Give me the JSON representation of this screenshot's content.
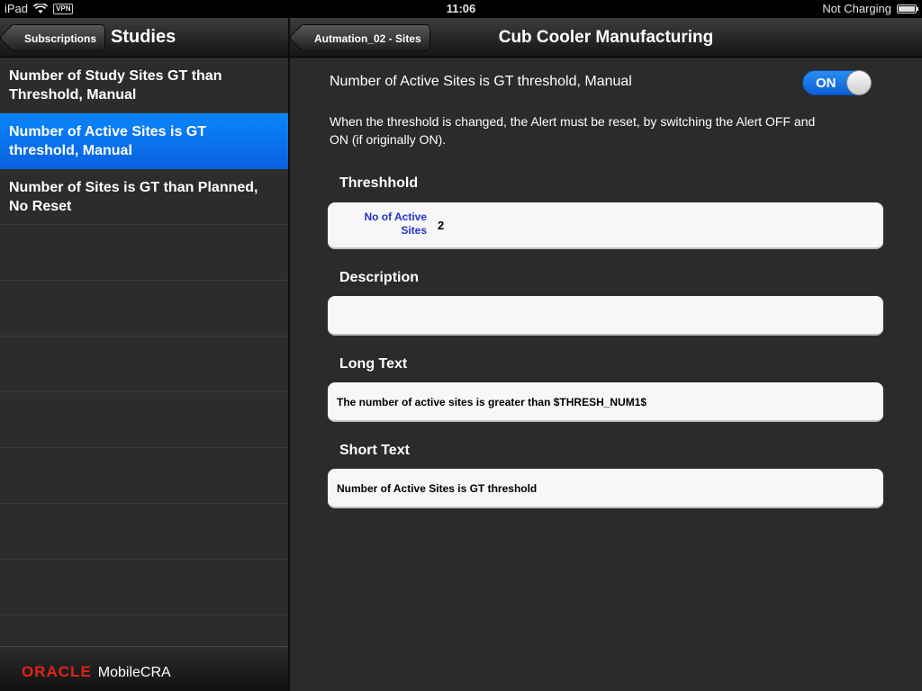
{
  "status_bar": {
    "device": "iPad",
    "vpn": "VPN",
    "time": "11:06",
    "charging": "Not Charging"
  },
  "master": {
    "back_label": "Subscriptions",
    "title": "Studies",
    "items": [
      {
        "label": "Number of Study Sites GT than Threshold, Manual",
        "selected": false
      },
      {
        "label": "Number of Active Sites is GT threshold, Manual",
        "selected": true
      },
      {
        "label": "Number of Sites is GT than Planned, No Reset",
        "selected": false
      }
    ],
    "brand": {
      "company": "ORACLE",
      "product": "MobileCRA"
    }
  },
  "detail": {
    "back_label": "Autmation_02 - Sites",
    "title": "Cub Cooler Manufacturing",
    "alert_name": "Number of Active Sites is GT threshold, Manual",
    "toggle_label": "ON",
    "note": "When the threshold is changed, the Alert must be reset, by switching the Alert OFF and ON (if originally ON).",
    "threshold": {
      "header": "Threshhold",
      "field_label": "No of Active Sites",
      "value": "2"
    },
    "description": {
      "header": "Description",
      "value": ""
    },
    "long_text": {
      "header": "Long Text",
      "value": "The number of active sites is greater than $THRESH_NUM1$"
    },
    "short_text": {
      "header": "Short Text",
      "value": "Number of Active Sites is GT threshold"
    }
  },
  "colors": {
    "selection": "#0a6ff0",
    "toggle_on": "#1a7ae6",
    "brand_red": "#e2231a",
    "field_label": "#2233cc"
  }
}
